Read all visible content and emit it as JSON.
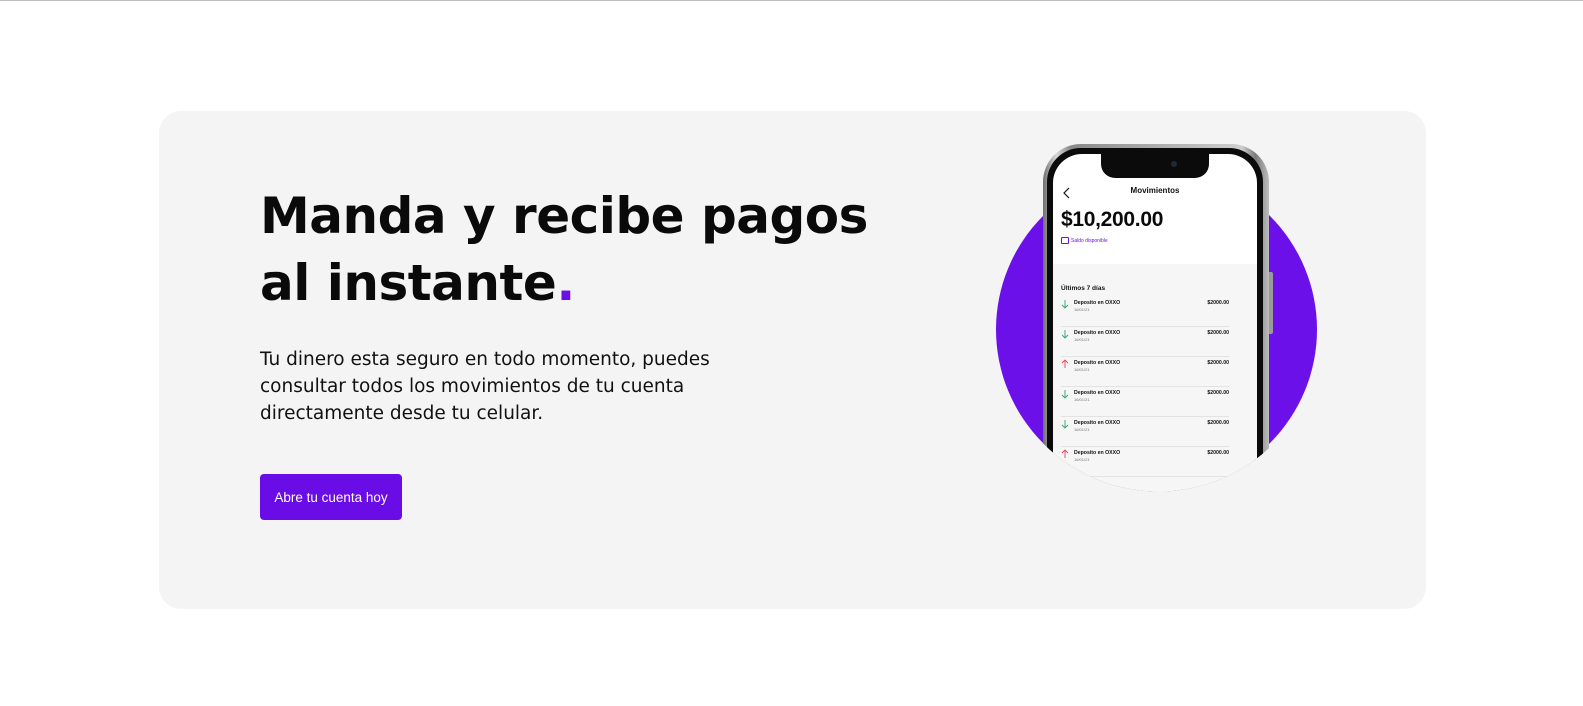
{
  "hero": {
    "headline": "Manda y recibe pagos al instante",
    "headline_dot": ".",
    "description": "Tu dinero esta seguro en todo momento, puedes consultar todos los movimientos de tu cuenta directamente desde tu celular.",
    "cta_label": "Abre tu cuenta hoy"
  },
  "phone": {
    "screen_title": "Movimientos",
    "balance": "$10,200.00",
    "balance_label": "Saldo disponible",
    "section_title": "Últimos 7 días",
    "transactions": [
      {
        "name": "Deposito en OXXO",
        "date": "16/01/21",
        "amount": "$2000.00",
        "direction": "in"
      },
      {
        "name": "Deposito en OXXO",
        "date": "16/01/21",
        "amount": "$2000.00",
        "direction": "in"
      },
      {
        "name": "Deposito en OXXO",
        "date": "16/01/21",
        "amount": "$2000.00",
        "direction": "out"
      },
      {
        "name": "Deposito en OXXO",
        "date": "16/01/21",
        "amount": "$2000.00",
        "direction": "in"
      },
      {
        "name": "Deposito en OXXO",
        "date": "16/01/21",
        "amount": "$2000.00",
        "direction": "in"
      },
      {
        "name": "Deposito en OXXO",
        "date": "16/01/21",
        "amount": "$2000.00",
        "direction": "out"
      }
    ]
  },
  "colors": {
    "accent": "#6a0ce5",
    "card_background": "#f4f4f4",
    "arrow_in": "#2aa86b",
    "arrow_out": "#e5484d"
  }
}
